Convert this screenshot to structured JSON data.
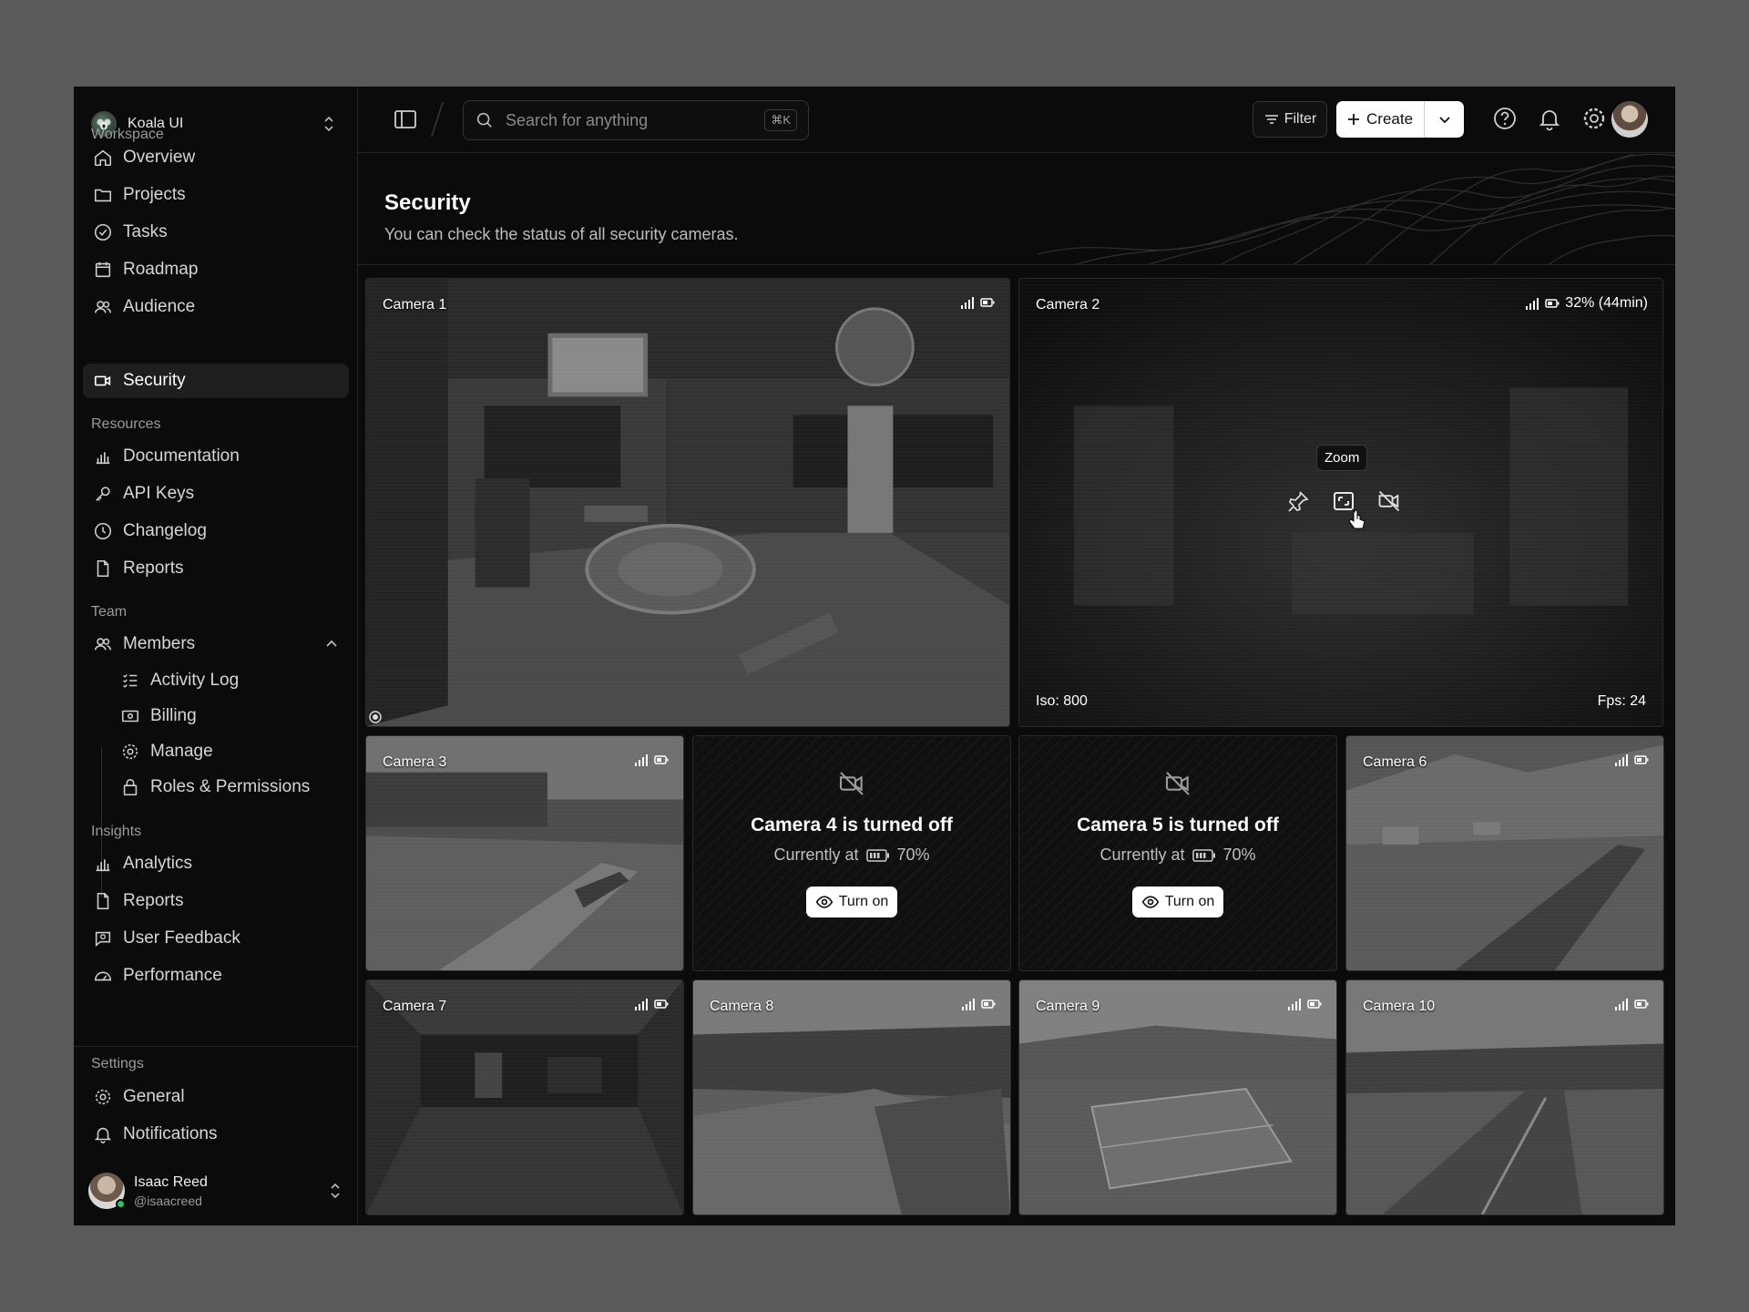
{
  "workspace": {
    "name": "Koala UI"
  },
  "sidebar": {
    "sections": {
      "workspace": "Workspace",
      "resources": "Resources",
      "team": "Team",
      "insights": "Insights",
      "settings": "Settings"
    },
    "workspace_items": [
      {
        "label": "Overview",
        "icon": "home-icon"
      },
      {
        "label": "Projects",
        "icon": "folder-icon"
      },
      {
        "label": "Tasks",
        "icon": "check-circle-icon"
      },
      {
        "label": "Roadmap",
        "icon": "calendar-icon"
      },
      {
        "label": "Audience",
        "icon": "users-icon"
      },
      {
        "label": "Security",
        "icon": "video-icon",
        "active": true
      }
    ],
    "resources_items": [
      {
        "label": "Documentation",
        "icon": "bar-chart-icon"
      },
      {
        "label": "API Keys",
        "icon": "key-icon"
      },
      {
        "label": "Changelog",
        "icon": "clock-icon"
      },
      {
        "label": "Reports",
        "icon": "file-icon"
      }
    ],
    "team_items": [
      {
        "label": "Members",
        "icon": "users-icon",
        "expanded": true
      }
    ],
    "member_subitems": [
      {
        "label": "Activity Log",
        "icon": "list-check-icon"
      },
      {
        "label": "Billing",
        "icon": "banknote-icon"
      },
      {
        "label": "Manage",
        "icon": "gear-icon"
      },
      {
        "label": "Roles & Permissions",
        "icon": "lock-icon"
      }
    ],
    "insights_items": [
      {
        "label": "Analytics",
        "icon": "bar-chart-icon"
      },
      {
        "label": "Reports",
        "icon": "file-icon"
      },
      {
        "label": "User Feedback",
        "icon": "message-search-icon"
      },
      {
        "label": "Performance",
        "icon": "gauge-icon"
      }
    ],
    "settings_items": [
      {
        "label": "General",
        "icon": "gear-icon"
      },
      {
        "label": "Notifications",
        "icon": "bell-icon"
      }
    ],
    "user": {
      "name": "Isaac Reed",
      "handle": "@isaacreed",
      "status_color": "#22c55e"
    }
  },
  "topbar": {
    "search_placeholder": "Search for anything",
    "search_shortcut": "⌘K",
    "filter_label": "Filter",
    "create_label": "Create"
  },
  "page": {
    "title": "Security",
    "subtitle": "You can check the status of all security cameras."
  },
  "cameras": [
    {
      "name": "Camera 1",
      "status": "on"
    },
    {
      "name": "Camera 2",
      "status": "on",
      "battery": "32% (44min)",
      "iso": "Iso: 800",
      "fps": "Fps: 24",
      "tooltip": "Zoom"
    },
    {
      "name": "Camera 3",
      "status": "on"
    },
    {
      "name": "Camera 4",
      "status": "off",
      "off_title": "Camera 4 is turned off",
      "off_prefix": "Currently at",
      "battery": "70%",
      "action": "Turn on"
    },
    {
      "name": "Camera 5",
      "status": "off",
      "off_title": "Camera 5 is turned off",
      "off_prefix": "Currently at",
      "battery": "70%",
      "action": "Turn on"
    },
    {
      "name": "Camera 6",
      "status": "on"
    },
    {
      "name": "Camera 7",
      "status": "on"
    },
    {
      "name": "Camera 8",
      "status": "on"
    },
    {
      "name": "Camera 9",
      "status": "on"
    },
    {
      "name": "Camera 10",
      "status": "on"
    }
  ],
  "colors": {
    "background": "#0b0b0b",
    "accent": "#ffffff",
    "online": "#22c55e"
  }
}
